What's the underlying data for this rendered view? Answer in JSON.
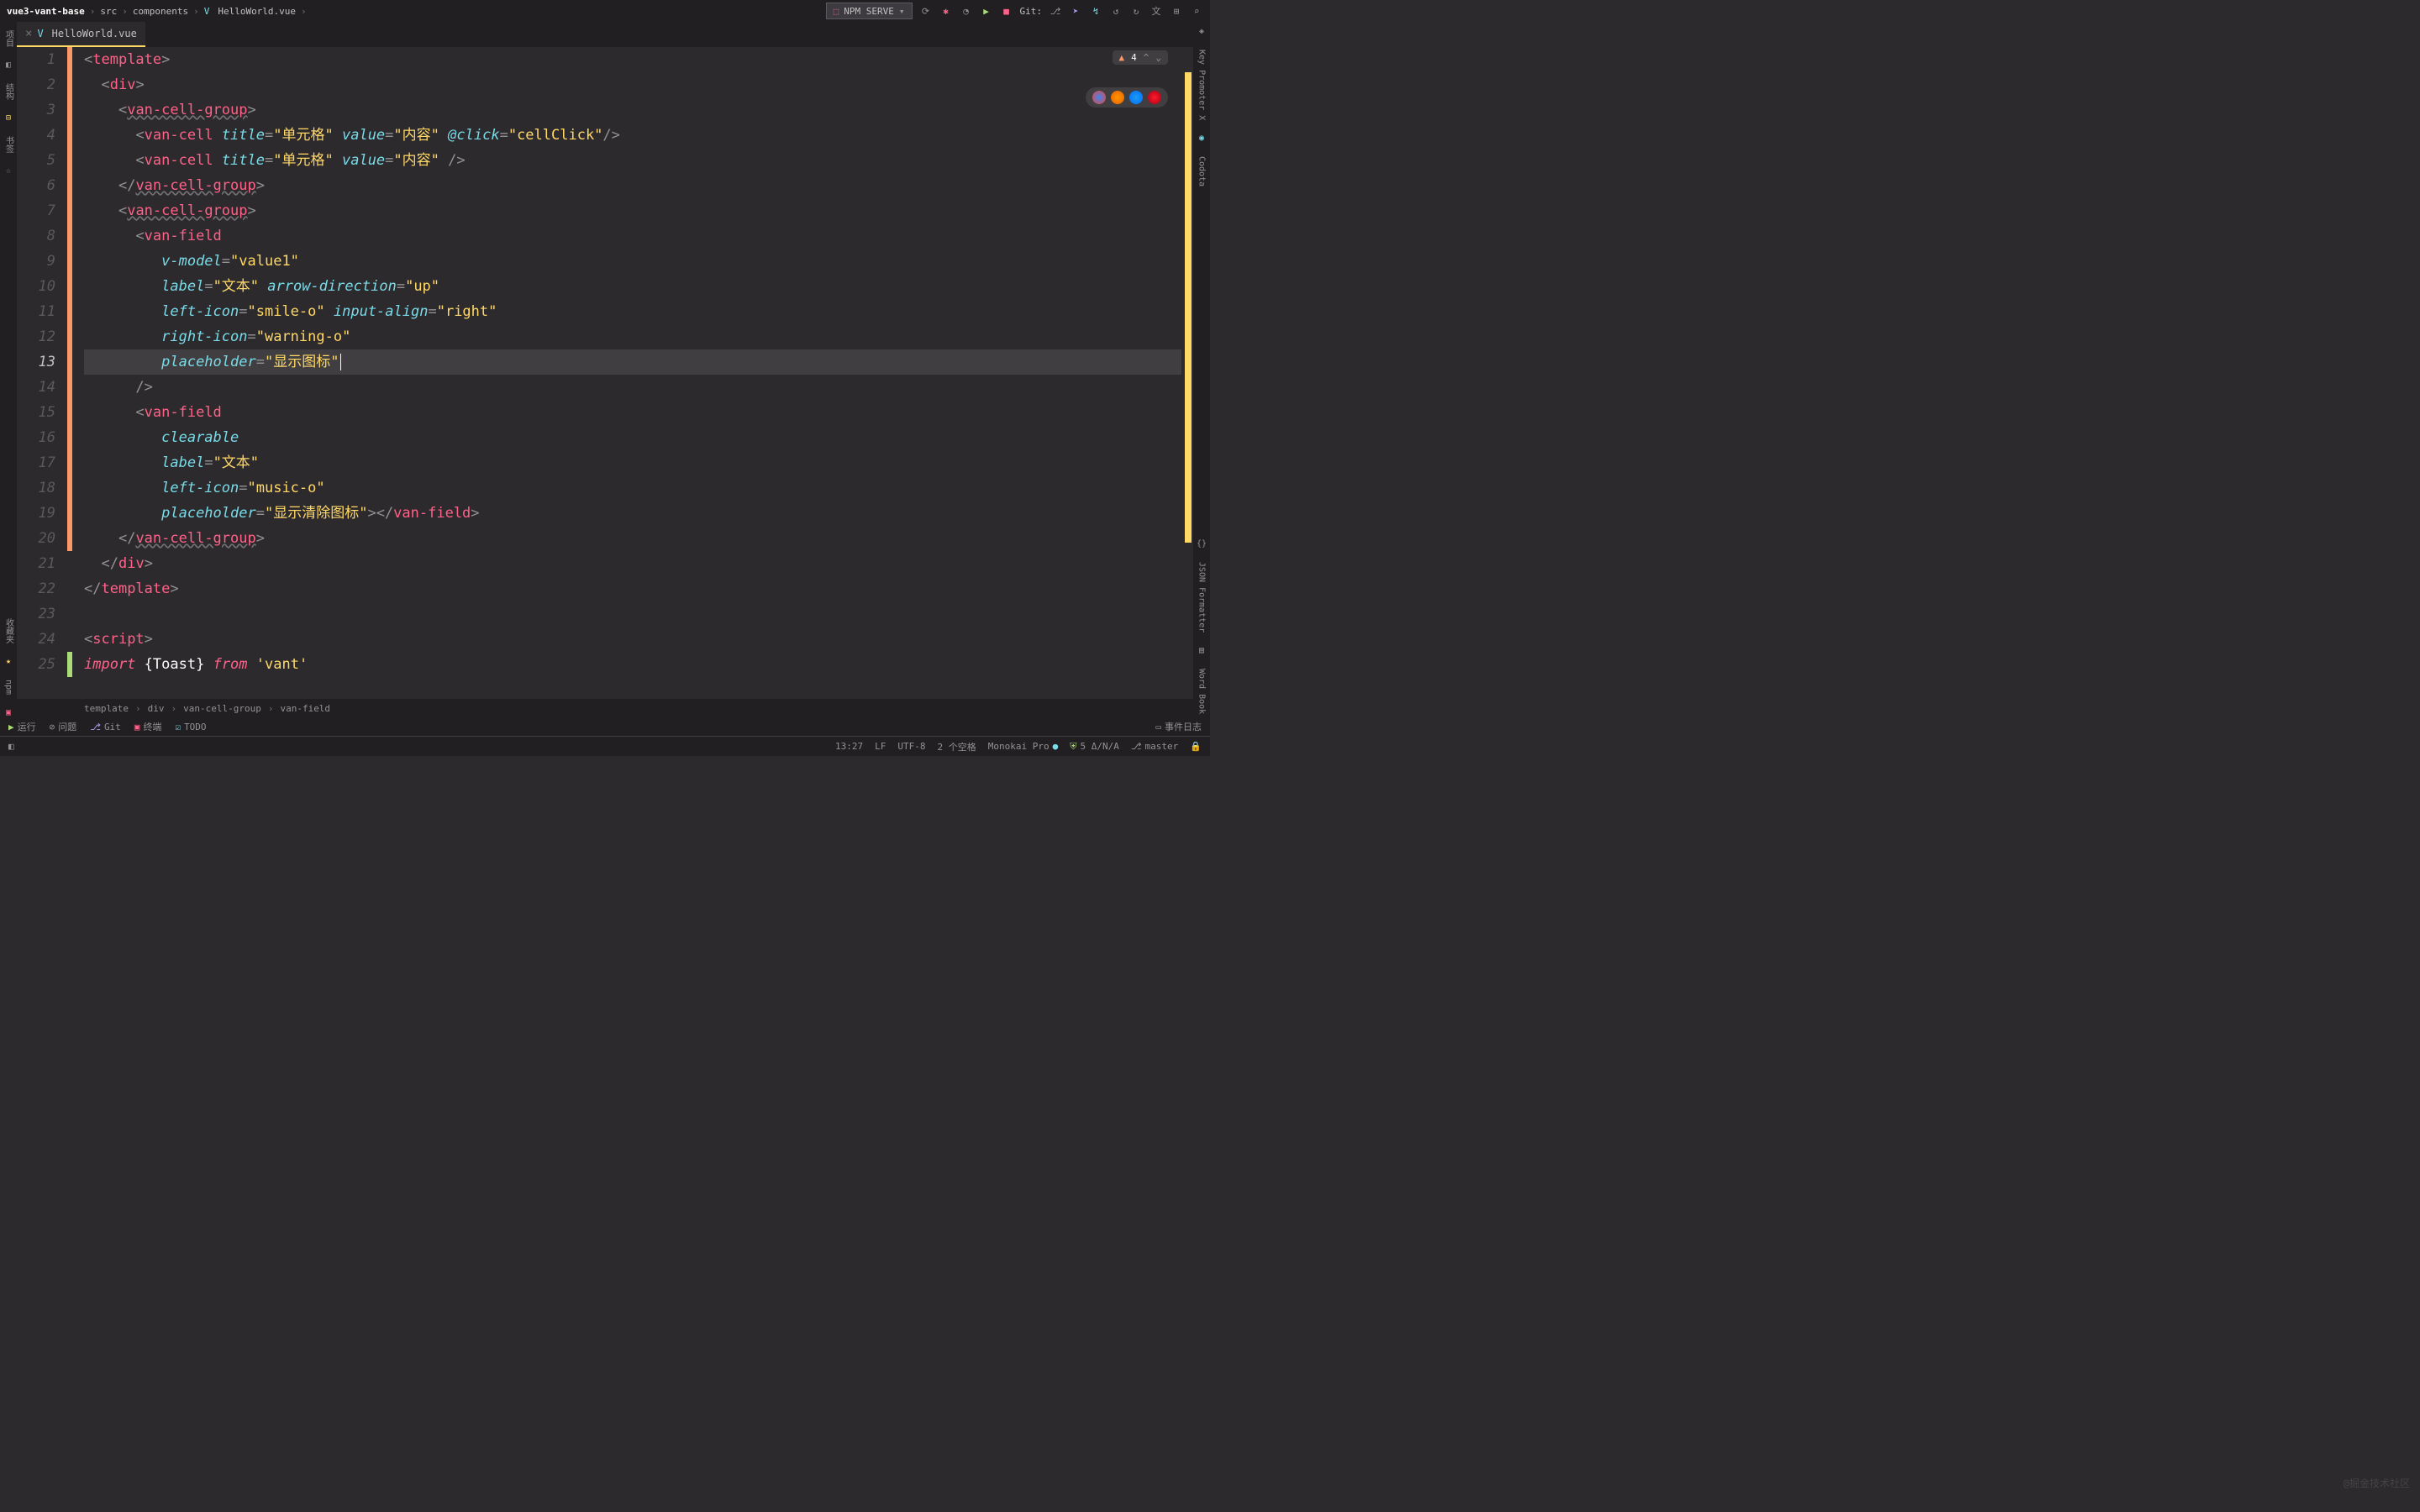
{
  "breadcrumb": {
    "project": "vue3-vant-base",
    "path": [
      "src",
      "components"
    ],
    "file": "HelloWorld.vue"
  },
  "run_config": {
    "label": "NPM SERVE"
  },
  "git_label": "Git:",
  "tab": {
    "filename": "HelloWorld.vue"
  },
  "inspection": {
    "count": "4"
  },
  "code_lines": [
    {
      "n": 1,
      "indent": 0,
      "type": "open-tag",
      "tag": "template"
    },
    {
      "n": 2,
      "indent": 1,
      "type": "open-tag",
      "tag": "div"
    },
    {
      "n": 3,
      "indent": 2,
      "type": "open-comp",
      "tag": "van-cell-group"
    },
    {
      "n": 4,
      "indent": 3,
      "type": "self-comp",
      "tag": "van-cell",
      "attrs": [
        [
          "title",
          "\"单元格\""
        ],
        [
          "value",
          "\"内容\""
        ],
        [
          "@click",
          "\"cellClick\""
        ]
      ]
    },
    {
      "n": 5,
      "indent": 3,
      "type": "self-comp",
      "tag": "van-cell",
      "attrs": [
        [
          "title",
          "\"单元格\""
        ],
        [
          "value",
          "\"内容\""
        ]
      ],
      "space_close": true
    },
    {
      "n": 6,
      "indent": 2,
      "type": "close-comp",
      "tag": "van-cell-group"
    },
    {
      "n": 7,
      "indent": 2,
      "type": "open-comp",
      "tag": "van-cell-group"
    },
    {
      "n": 8,
      "indent": 3,
      "type": "open-comp-noclose",
      "tag": "van-field"
    },
    {
      "n": 9,
      "indent": 4,
      "type": "attr-only",
      "attrs": [
        [
          "v-model",
          "\"value1\""
        ]
      ]
    },
    {
      "n": 10,
      "indent": 4,
      "type": "attr-only",
      "attrs": [
        [
          "label",
          "\"文本\""
        ],
        [
          "arrow-direction",
          "\"up\""
        ]
      ]
    },
    {
      "n": 11,
      "indent": 4,
      "type": "attr-only",
      "attrs": [
        [
          "left-icon",
          "\"smile-o\""
        ],
        [
          "input-align",
          "\"right\""
        ]
      ]
    },
    {
      "n": 12,
      "indent": 4,
      "type": "attr-only",
      "attrs": [
        [
          "right-icon",
          "\"warning-o\""
        ]
      ]
    },
    {
      "n": 13,
      "indent": 4,
      "type": "attr-only",
      "attrs": [
        [
          "placeholder",
          "\"显示图标\""
        ]
      ],
      "cursor": true,
      "highlighted": true
    },
    {
      "n": 14,
      "indent": 3,
      "type": "self-close-only"
    },
    {
      "n": 15,
      "indent": 3,
      "type": "open-comp-noclose",
      "tag": "van-field"
    },
    {
      "n": 16,
      "indent": 4,
      "type": "bare-attr",
      "name": "clearable"
    },
    {
      "n": 17,
      "indent": 4,
      "type": "attr-only",
      "attrs": [
        [
          "label",
          "\"文本\""
        ]
      ]
    },
    {
      "n": 18,
      "indent": 4,
      "type": "attr-only",
      "attrs": [
        [
          "left-icon",
          "\"music-o\""
        ]
      ]
    },
    {
      "n": 19,
      "indent": 4,
      "type": "attr-close-comp",
      "attrs": [
        [
          "placeholder",
          "\"显示清除图标\""
        ]
      ],
      "close_tag": "van-field"
    },
    {
      "n": 20,
      "indent": 2,
      "type": "close-comp",
      "tag": "van-cell-group"
    },
    {
      "n": 21,
      "indent": 1,
      "type": "close-tag",
      "tag": "div"
    },
    {
      "n": 22,
      "indent": 0,
      "type": "close-tag",
      "tag": "template"
    },
    {
      "n": 23,
      "indent": 0,
      "type": "blank"
    },
    {
      "n": 24,
      "indent": 0,
      "type": "open-tag",
      "tag": "script"
    },
    {
      "n": 25,
      "indent": 0,
      "type": "import",
      "what": "{Toast}",
      "from": "'vant'"
    }
  ],
  "breadcrumb_bottom": [
    "template",
    "div",
    "van-cell-group",
    "van-field"
  ],
  "tool_windows": {
    "run": "运行",
    "problems": "问题",
    "git": "Git",
    "terminal": "终端",
    "todo": "TODO",
    "event_log": "事件日志"
  },
  "status": {
    "cursor": "13:27",
    "line_sep": "LF",
    "encoding": "UTF-8",
    "indent": "2 个空格",
    "theme": "Monokai Pro",
    "power": "5 Δ/N/A",
    "branch": "master"
  },
  "left_tabs": [
    "项目",
    "结构",
    "书签"
  ],
  "right_tabs": [
    "Key Promoter X",
    "Codota",
    "JSON Formatter",
    "Word Book"
  ],
  "left_bottom": [
    "收藏夹",
    "npm"
  ],
  "watermark": "@掘金技术社区"
}
